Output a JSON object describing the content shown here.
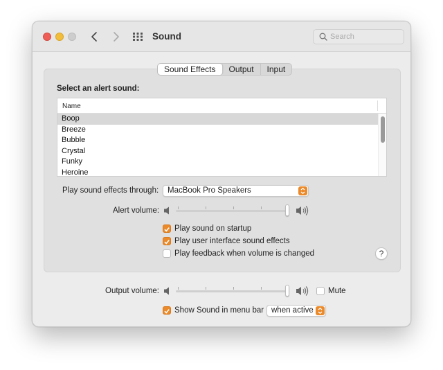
{
  "window": {
    "title": "Sound"
  },
  "search": {
    "placeholder": "Search"
  },
  "tabs": [
    {
      "label": "Sound Effects",
      "active": true
    },
    {
      "label": "Output",
      "active": false
    },
    {
      "label": "Input",
      "active": false
    }
  ],
  "alert_sounds": {
    "heading": "Select an alert sound:",
    "column_header": "Name",
    "items": [
      "Boop",
      "Breeze",
      "Bubble",
      "Crystal",
      "Funky",
      "Heroine"
    ],
    "selected": "Boop"
  },
  "play_through": {
    "label": "Play sound effects through:",
    "value": "MacBook Pro Speakers"
  },
  "alert_volume": {
    "label": "Alert volume:",
    "level": 1.0
  },
  "checkboxes": [
    {
      "label": "Play sound on startup",
      "checked": true
    },
    {
      "label": "Play user interface sound effects",
      "checked": true
    },
    {
      "label": "Play feedback when volume is changed",
      "checked": false
    }
  ],
  "help": {
    "label": "?"
  },
  "output_volume": {
    "label": "Output volume:",
    "level": 1.0,
    "mute_label": "Mute",
    "muted": false
  },
  "menu_bar": {
    "label": "Show Sound in menu bar",
    "checked": true,
    "option": "when active"
  },
  "colors": {
    "accent": "#ea8a2a",
    "close": "#ee5e56",
    "minimize": "#f2bd3b",
    "zoom_disabled": "#cdcdcd"
  }
}
